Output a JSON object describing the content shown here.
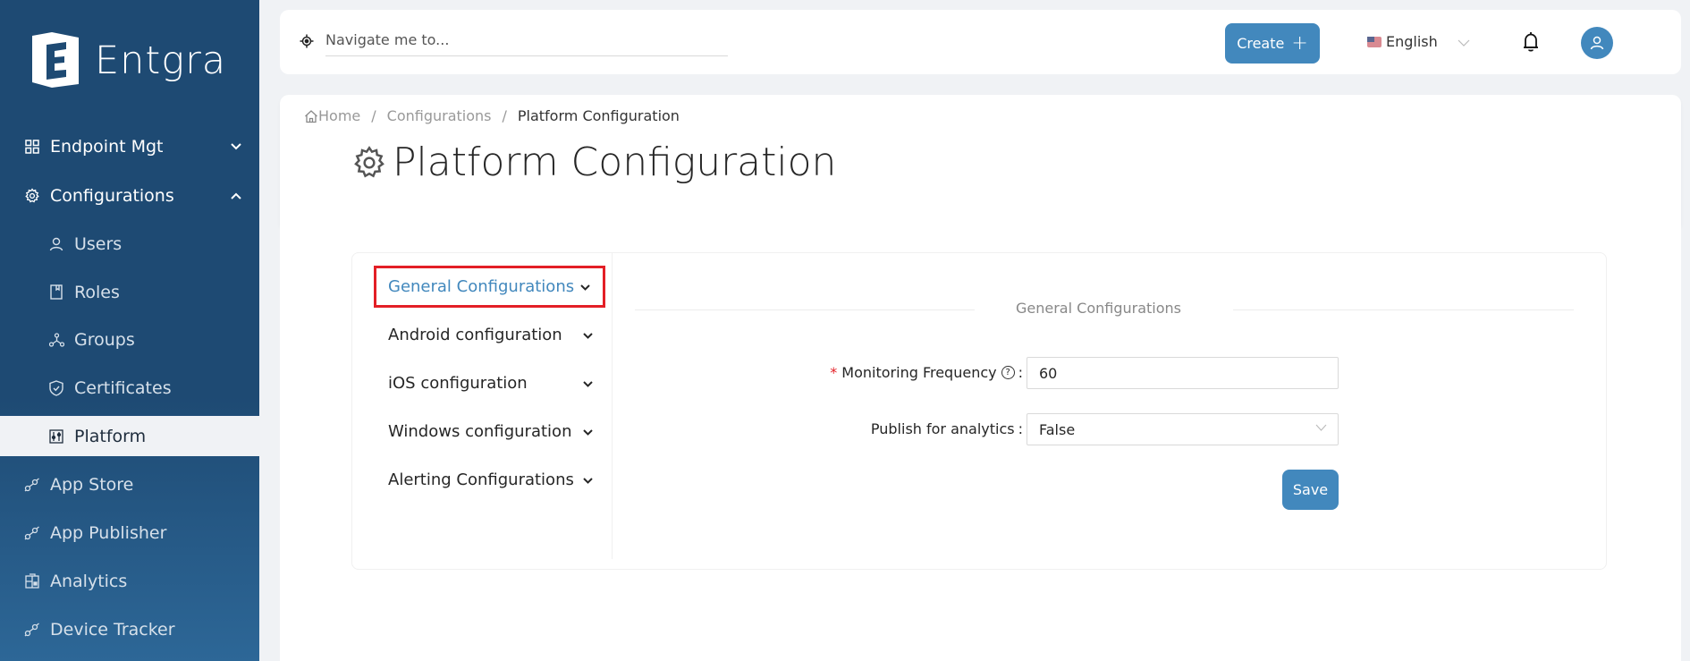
{
  "brand": {
    "name": "Entgra"
  },
  "sidebar": {
    "items": [
      {
        "label": "Endpoint Mgt",
        "icon": "grid-icon",
        "expanded": false
      },
      {
        "label": "Configurations",
        "icon": "gear-icon",
        "expanded": true
      },
      {
        "label": "Users",
        "icon": "user-icon"
      },
      {
        "label": "Roles",
        "icon": "book-icon"
      },
      {
        "label": "Groups",
        "icon": "nodes-icon"
      },
      {
        "label": "Certificates",
        "icon": "shield-check-icon"
      },
      {
        "label": "Platform",
        "icon": "sliders-icon",
        "active": true
      },
      {
        "label": "App Store",
        "icon": "link-icon"
      },
      {
        "label": "App Publisher",
        "icon": "link-icon"
      },
      {
        "label": "Analytics",
        "icon": "dashboard-icon"
      },
      {
        "label": "Device Tracker",
        "icon": "link-icon"
      }
    ],
    "chevron_down": "⌄",
    "chevron_up": "⌃"
  },
  "header": {
    "search_placeholder": "Navigate me to...",
    "create_label": "Create",
    "create_icon": "+",
    "language": "English"
  },
  "breadcrumb": {
    "items": [
      "Home",
      "Configurations",
      "Platform Configuration"
    ],
    "separator": "/"
  },
  "page": {
    "title": "Platform Configuration"
  },
  "config_menu": {
    "items": [
      {
        "label": "General Configurations",
        "selected": true
      },
      {
        "label": "Android configuration"
      },
      {
        "label": "iOS configuration"
      },
      {
        "label": "Windows configuration"
      },
      {
        "label": "Alerting Configurations"
      }
    ]
  },
  "form": {
    "section_title": "General Configurations",
    "monitoring_frequency": {
      "label": "Monitoring Frequency",
      "required_mark": "*",
      "help": "?",
      "value": "60"
    },
    "publish_analytics": {
      "label": "Publish for analytics",
      "value": "False"
    },
    "colon": ":",
    "save_label": "Save"
  },
  "colors": {
    "sidebar": "#1e4a73",
    "accent": "#4288bd",
    "highlight_border": "#e31f26"
  }
}
